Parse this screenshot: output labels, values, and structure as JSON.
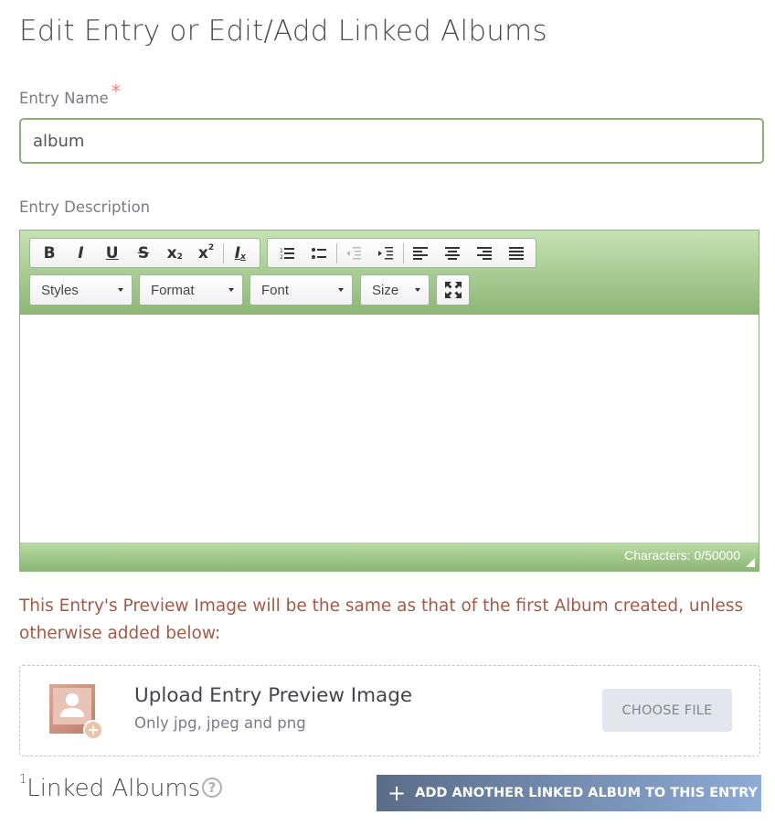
{
  "page": {
    "title": "Edit Entry or Edit/Add Linked Albums"
  },
  "entry_name": {
    "label": "Entry Name",
    "required_mark": "*",
    "value": "album"
  },
  "entry_description": {
    "label": "Entry Description",
    "toolbar": {
      "buttons": [
        "bold-icon",
        "italic-icon",
        "underline-icon",
        "strikethrough-icon",
        "subscript-icon",
        "superscript-icon",
        "remove-format-icon",
        "numbered-list-icon",
        "bulleted-list-icon",
        "outdent-icon",
        "indent-icon",
        "align-left-icon",
        "align-center-icon",
        "align-right-icon",
        "justify-icon"
      ],
      "styles": "Styles",
      "format": "Format",
      "font": "Font",
      "size": "Size"
    },
    "char_count": "Characters: 0/50000",
    "colors": {
      "toolbar_top": "#c5e2b3",
      "toolbar_bottom": "#8db676",
      "border": "#8fb27c"
    }
  },
  "preview_note": "This Entry's Preview Image will be the same as that of the first Album created, unless otherwise added below:",
  "upload": {
    "title": "Upload Entry Preview Image",
    "subtitle": "Only jpg, jpeg and png",
    "button": "CHOOSE FILE"
  },
  "linked_albums": {
    "superscript": "1",
    "title": "Linked Albums",
    "help_icon": "?",
    "add_button": "ADD ANOTHER LINKED ALBUM TO THIS ENTRY",
    "add_icon": "+"
  },
  "colors": {
    "accent_green": "#8cb07a",
    "note_text": "#a35a47",
    "button_blue_start": "#5a6d89",
    "button_blue_end": "#8dabd5"
  }
}
